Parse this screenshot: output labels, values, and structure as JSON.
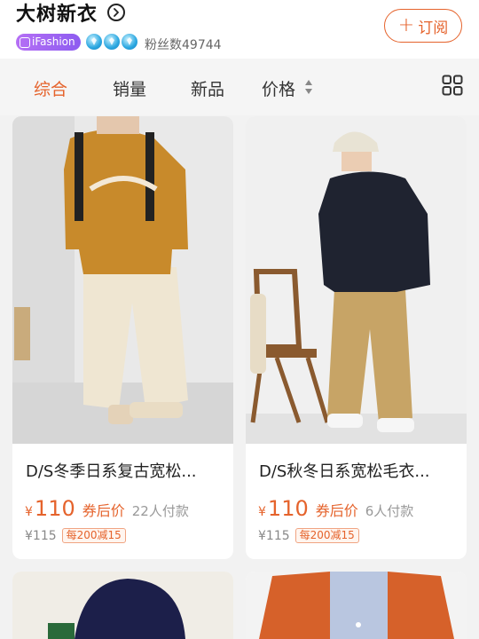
{
  "header": {
    "shop_name": "大树新衣",
    "badge_label": "iFashion",
    "fans_text": "粉丝数49744",
    "subscribe_plus": "+",
    "subscribe_label": "订阅"
  },
  "tabs": [
    {
      "label": "综合",
      "active": true
    },
    {
      "label": "销量",
      "active": false
    },
    {
      "label": "新品",
      "active": false
    },
    {
      "label": "价格",
      "active": false
    }
  ],
  "products": [
    {
      "title": "D/S冬季日系复古宽松...",
      "currency": "¥",
      "price": "110",
      "coupon_label": "券后价",
      "paid_count": "22人付款",
      "original_price": "¥115",
      "promo": "每200减15"
    },
    {
      "title": "D/S秋冬日系宽松毛衣...",
      "currency": "¥",
      "price": "110",
      "coupon_label": "券后价",
      "paid_count": "6人付款",
      "original_price": "¥115",
      "promo": "每200减15"
    }
  ],
  "icons": [
    "chevron-right-circle-icon",
    "ifashion-badge-icon",
    "diamond-level-icon",
    "sort-arrows-icon",
    "grid-view-icon"
  ],
  "colors": {
    "accent": "#e5632c",
    "badge": "#9a60f2",
    "background": "#f2f2f2"
  }
}
